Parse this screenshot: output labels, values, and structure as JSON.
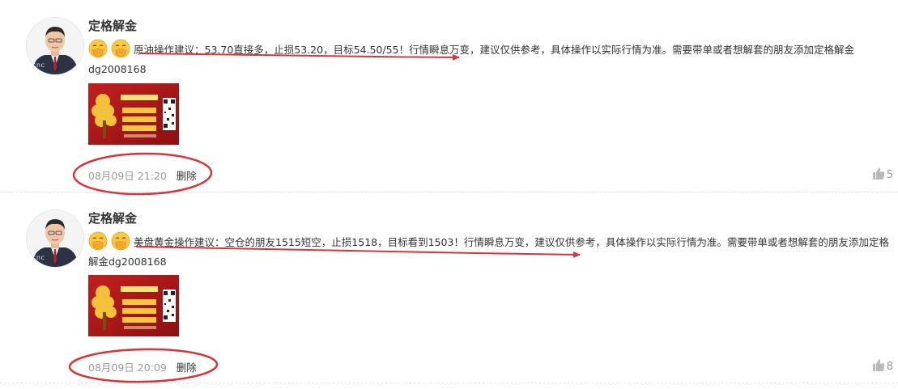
{
  "posts": [
    {
      "author": "定格解金",
      "emojis": [
        "cover-mouth-emoji-icon",
        "cover-mouth-emoji-icon"
      ],
      "text": "原油操作建议：53.70直接多，止损53.20，目标54.50/55！行情瞬息万变，建议仅供参考，具体操作以实际行情为准。需要带单或者想解套的朋友添加定格解金dg2008168",
      "time": "08月09日 21:20",
      "delete_label": "删除",
      "likes": "5"
    },
    {
      "author": "定格解金",
      "emojis": [
        "cover-mouth-emoji-icon",
        "cover-mouth-emoji-icon"
      ],
      "text": "美盘黄金操作建议：空仓的朋友1515短空，止损1518，目标看到1503！行情瞬息万变，建议仅供参考，具体操作以实际行情为准。需要带单或者想解套的朋友添加定格解金dg2008168",
      "time": "08月09日 20:09",
      "delete_label": "删除",
      "likes": "8"
    }
  ],
  "avatar_watermark": "cnc",
  "colors": {
    "annotation_red": "#d9343a",
    "promo_red": "#a8161a",
    "meta_gray": "#999999"
  }
}
